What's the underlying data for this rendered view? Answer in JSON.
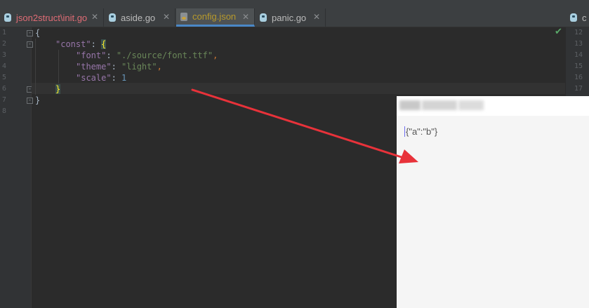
{
  "tabs": [
    {
      "label": "json2struct\\init.go",
      "close": "✕",
      "icon": "go-gopher-icon",
      "color": "#e06c75"
    },
    {
      "label": "aside.go",
      "close": "✕",
      "icon": "go-gopher-icon",
      "color": "#bbbbbb"
    },
    {
      "label": "config.json",
      "close": "✕",
      "icon": "json-file-icon",
      "color": "#b89a2b"
    },
    {
      "label": "panic.go",
      "close": "✕",
      "icon": "go-gopher-icon",
      "color": "#bbbbbb"
    },
    {
      "label": "c",
      "icon": "go-gopher-icon",
      "color": "#bbbbbb"
    }
  ],
  "gutter": {
    "lines": [
      "1",
      "2",
      "3",
      "4",
      "5",
      "6",
      "7",
      "8"
    ]
  },
  "code": {
    "l1_brace": "{",
    "l2_key": "\"const\"",
    "l2_colon": ": ",
    "l2_brace": "{",
    "l3_key": "\"font\"",
    "l3_colon": ": ",
    "l3_val": "\"./source/font.ttf\"",
    "l3_comma": ",",
    "l4_key": "\"theme\"",
    "l4_colon": ": ",
    "l4_val": "\"light\"",
    "l4_comma": ",",
    "l5_key": "\"scale\"",
    "l5_colon": ": ",
    "l5_val": "1",
    "l6_brace": "}",
    "l7_brace": "}"
  },
  "right_gutter": {
    "lines": [
      "12",
      "13",
      "14",
      "15",
      "16",
      "17"
    ]
  },
  "output_window": {
    "text": "{\"a\":\"b\"}"
  },
  "colors": {
    "arrow": "#e8323a",
    "active_tab_underline": "#4a88c7"
  }
}
